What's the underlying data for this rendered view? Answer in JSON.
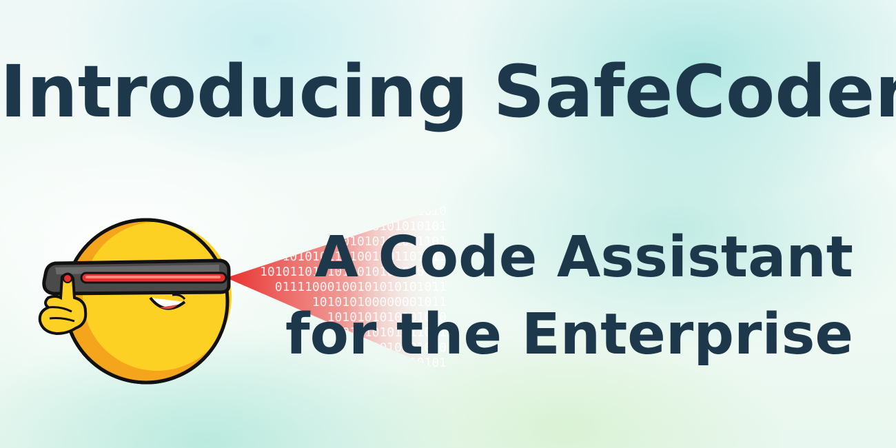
{
  "title": "Introducing SafeCoder",
  "subtitle": {
    "line1": "A Code Assistant",
    "line2": "for the Enterprise"
  },
  "binary_rows": [
    "1010101010101010",
    "0101010101010101",
    "0101010101011101",
    "1010101111001001101011",
    "1010110101011010100010101",
    "01111000100101010101011",
    "101010100000001011",
    "1010101010101010",
    "0001110101111011",
    "1110001010101010",
    "0101010101010101"
  ],
  "colors": {
    "title": "#1e384b",
    "face": "#fdd124",
    "beam": "#e8302e",
    "visor": "#4a4a4a"
  },
  "icons": [
    "emoji-face-icon",
    "visor-icon",
    "laser-beam-icon",
    "pointing-hand-icon"
  ]
}
